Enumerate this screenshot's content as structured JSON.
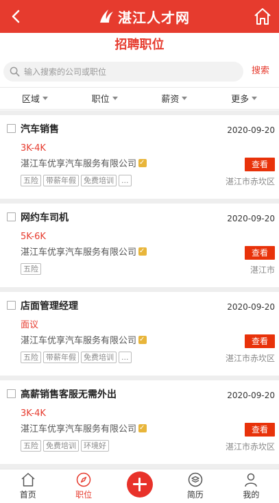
{
  "header": {
    "site_name": "湛江人才网",
    "back_icon": "chevron-left-icon",
    "home_icon": "home-icon",
    "bg_color": "#e63b2e"
  },
  "page_title": "招聘职位",
  "search": {
    "placeholder": "输入搜索的公司或职位",
    "button_label": "搜索"
  },
  "filters": [
    {
      "label": "区域"
    },
    {
      "label": "职位"
    },
    {
      "label": "薪资"
    },
    {
      "label": "更多"
    }
  ],
  "jobs": [
    {
      "title": "汽车销售",
      "date": "2020-09-20",
      "salary": "3K-4K",
      "company": "湛江车优享汽车服务有限公司",
      "tags": [
        "五险",
        "带薪年假",
        "免费培训",
        "..."
      ],
      "location": "湛江市赤坎区",
      "view_label": "查看"
    },
    {
      "title": "网约车司机",
      "date": "2020-09-20",
      "salary": "5K-6K",
      "company": "湛江车优享汽车服务有限公司",
      "tags": [
        "五险"
      ],
      "location": "湛江市",
      "view_label": "查看"
    },
    {
      "title": "店面管理经理",
      "date": "2020-09-20",
      "salary": "面议",
      "company": "湛江车优享汽车服务有限公司",
      "tags": [
        "五险",
        "带薪年假",
        "免费培训",
        "..."
      ],
      "location": "湛江市赤坎区",
      "view_label": "查看"
    },
    {
      "title": "高薪销售客服无需外出",
      "date": "2020-09-20",
      "salary": "3K-4K",
      "company": "湛江车优享汽车服务有限公司",
      "tags": [
        "五险",
        "免费培训",
        "环境好"
      ],
      "location": "湛江市赤坎区",
      "view_label": "查看"
    }
  ],
  "bottom_nav": [
    {
      "label": "首页",
      "icon": "home-icon"
    },
    {
      "label": "职位",
      "icon": "compass-icon",
      "active": true
    },
    {
      "label": "",
      "icon": "plus-icon"
    },
    {
      "label": "简历",
      "icon": "resume-icon"
    },
    {
      "label": "我的",
      "icon": "user-icon"
    }
  ]
}
